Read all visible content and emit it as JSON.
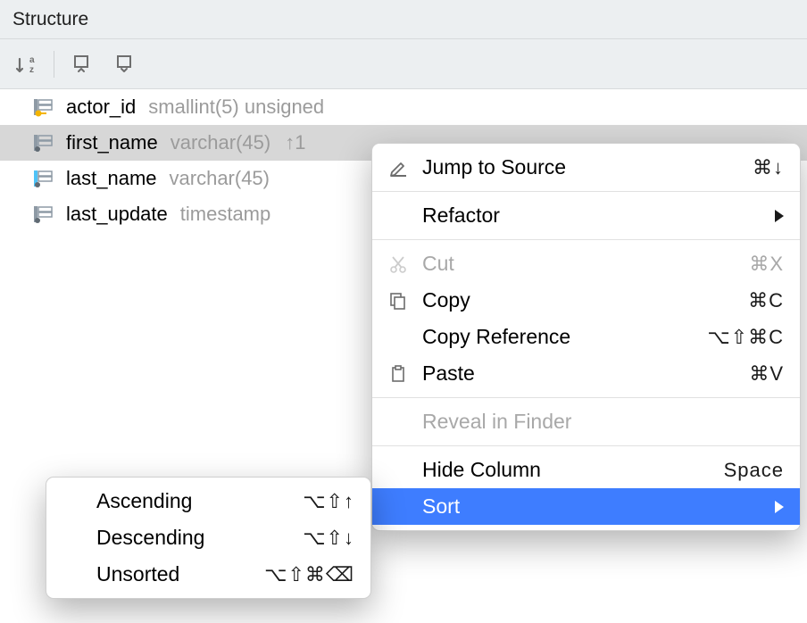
{
  "panel": {
    "title": "Structure"
  },
  "columns": [
    {
      "name": "actor_id",
      "type": "smallint(5) unsigned",
      "extra": "",
      "icon": "pk",
      "selected": false
    },
    {
      "name": "first_name",
      "type": "varchar(45)",
      "extra": "↑1",
      "icon": "col",
      "selected": true
    },
    {
      "name": "last_name",
      "type": "varchar(45)",
      "extra": "",
      "icon": "idx",
      "selected": false
    },
    {
      "name": "last_update",
      "type": "timestamp",
      "extra": "",
      "icon": "col",
      "selected": false
    }
  ],
  "context_menu": {
    "jump_to_source": {
      "label": "Jump to Source",
      "shortcut": "⌘↓"
    },
    "refactor": {
      "label": "Refactor"
    },
    "cut": {
      "label": "Cut",
      "shortcut": "⌘X"
    },
    "copy": {
      "label": "Copy",
      "shortcut": "⌘C"
    },
    "copy_reference": {
      "label": "Copy Reference",
      "shortcut": "⌥⇧⌘C"
    },
    "paste": {
      "label": "Paste",
      "shortcut": "⌘V"
    },
    "reveal": {
      "label": "Reveal in Finder"
    },
    "hide_column": {
      "label": "Hide Column",
      "shortcut": "Space"
    },
    "sort": {
      "label": "Sort"
    }
  },
  "sort_submenu": {
    "asc": {
      "label": "Ascending",
      "shortcut": "⌥⇧↑"
    },
    "desc": {
      "label": "Descending",
      "shortcut": "⌥⇧↓"
    },
    "unsorted": {
      "label": "Unsorted",
      "shortcut": "⌥⇧⌘⌫"
    }
  }
}
